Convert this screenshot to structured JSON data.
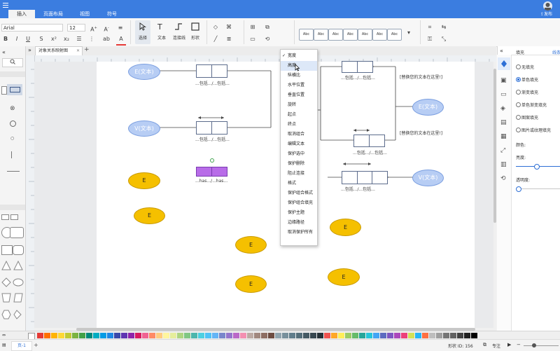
{
  "menu": {
    "tabs": [
      "插入",
      "页面布局",
      "视图",
      "符号"
    ],
    "active_index": 0
  },
  "ribbon": {
    "font_name": "Arial",
    "font_size": "12",
    "tools": {
      "select": "选择",
      "text": "文本",
      "connector": "连接线",
      "shape": "形状"
    },
    "style_swatch_label": "Abc",
    "style_swatch_count": 7
  },
  "document_tab": {
    "title": "对象关系映射图"
  },
  "context_menu": {
    "items": [
      "宽度",
      "高度",
      "纵横比",
      "水平位置",
      "垂直位置",
      "旋转",
      "起点",
      "终点",
      "取消组合",
      "编辑文本",
      "保护选中",
      "保护删除",
      "阻止连接",
      "格式",
      "保护组合格式",
      "保护组合填充",
      "保护主题",
      "边缘路径",
      "取消保护所有"
    ],
    "checked_index": 0,
    "hover_index": 1
  },
  "diagram": {
    "entity_e_text": "E(文本)",
    "entity_v_text": "V(文本)",
    "entity_short": "E",
    "relation_label_contains": "...包括.../...包括...",
    "relation_label_has": "...has.../...has...",
    "comment_text": "[替换您的文本在这里!]"
  },
  "right_panel": {
    "tabs": [
      "填充",
      "线条"
    ],
    "fill_options": [
      "无填充",
      "单色填充",
      "渐变填充",
      "单色渐变填充",
      "图案填充",
      "图片或纹理填充"
    ],
    "selected_fill_index": 1,
    "color_label": "颜色:",
    "brightness_label": "亮度:",
    "transparency_label": "透明度:",
    "brightness_level": 0.45,
    "transparency_level": 0.0
  },
  "status_bar": {
    "page": "页-1",
    "shape_id": "形状 ID:  156",
    "focus": "专注"
  },
  "colors": {
    "title_bar": "#3b7de0",
    "entity_blue": "#b7cdf4",
    "entity_yellow": "#f5c000",
    "selected_shape": "#b86ce8",
    "accent": "#2d6fd6"
  },
  "palette_colors": [
    "#e53935",
    "#ff6f00",
    "#ffb300",
    "#fdd835",
    "#c0ca33",
    "#7cb342",
    "#43a047",
    "#00897b",
    "#00acc1",
    "#039be5",
    "#1e88e5",
    "#3949ab",
    "#5e35b1",
    "#8e24aa",
    "#d81b60",
    "#f06292",
    "#ff8a65",
    "#ffcc80",
    "#fff59d",
    "#e6ee9c",
    "#aed581",
    "#81c784",
    "#4db6ac",
    "#4dd0e1",
    "#4fc3f7",
    "#64b5f6",
    "#7986cb",
    "#9575cd",
    "#ba68c8",
    "#f48fb1",
    "#bcaaa4",
    "#a1887f",
    "#8d6e63",
    "#6d4c41",
    "#90a4ae",
    "#78909c",
    "#607d8b",
    "#546e7a",
    "#455a64",
    "#37474f",
    "#263238",
    "#ef5350",
    "#ffa726",
    "#ffee58",
    "#9ccc65",
    "#66bb6a",
    "#26a69a",
    "#26c6da",
    "#42a5f5",
    "#5c6bc0",
    "#7e57c2",
    "#ab47bc",
    "#ec407a",
    "#d4e157",
    "#29b6f6",
    "#ff7043",
    "#bdbdbd",
    "#9e9e9e",
    "#757575",
    "#616161",
    "#424242",
    "#212121",
    "#000000"
  ],
  "icons": [
    "undo-icon",
    "redo-icon",
    "save-icon",
    "print-icon",
    "bold-icon",
    "italic-icon",
    "underline-icon",
    "pointer-icon",
    "text-icon",
    "connector-icon",
    "shape-icon",
    "fill-icon",
    "line-icon",
    "arrange-icon",
    "lock-icon",
    "search-icon",
    "fill-panel-icon",
    "layers-icon",
    "history-icon",
    "avatar-icon",
    "publish-icon"
  ],
  "header": {
    "publish": "发布"
  }
}
